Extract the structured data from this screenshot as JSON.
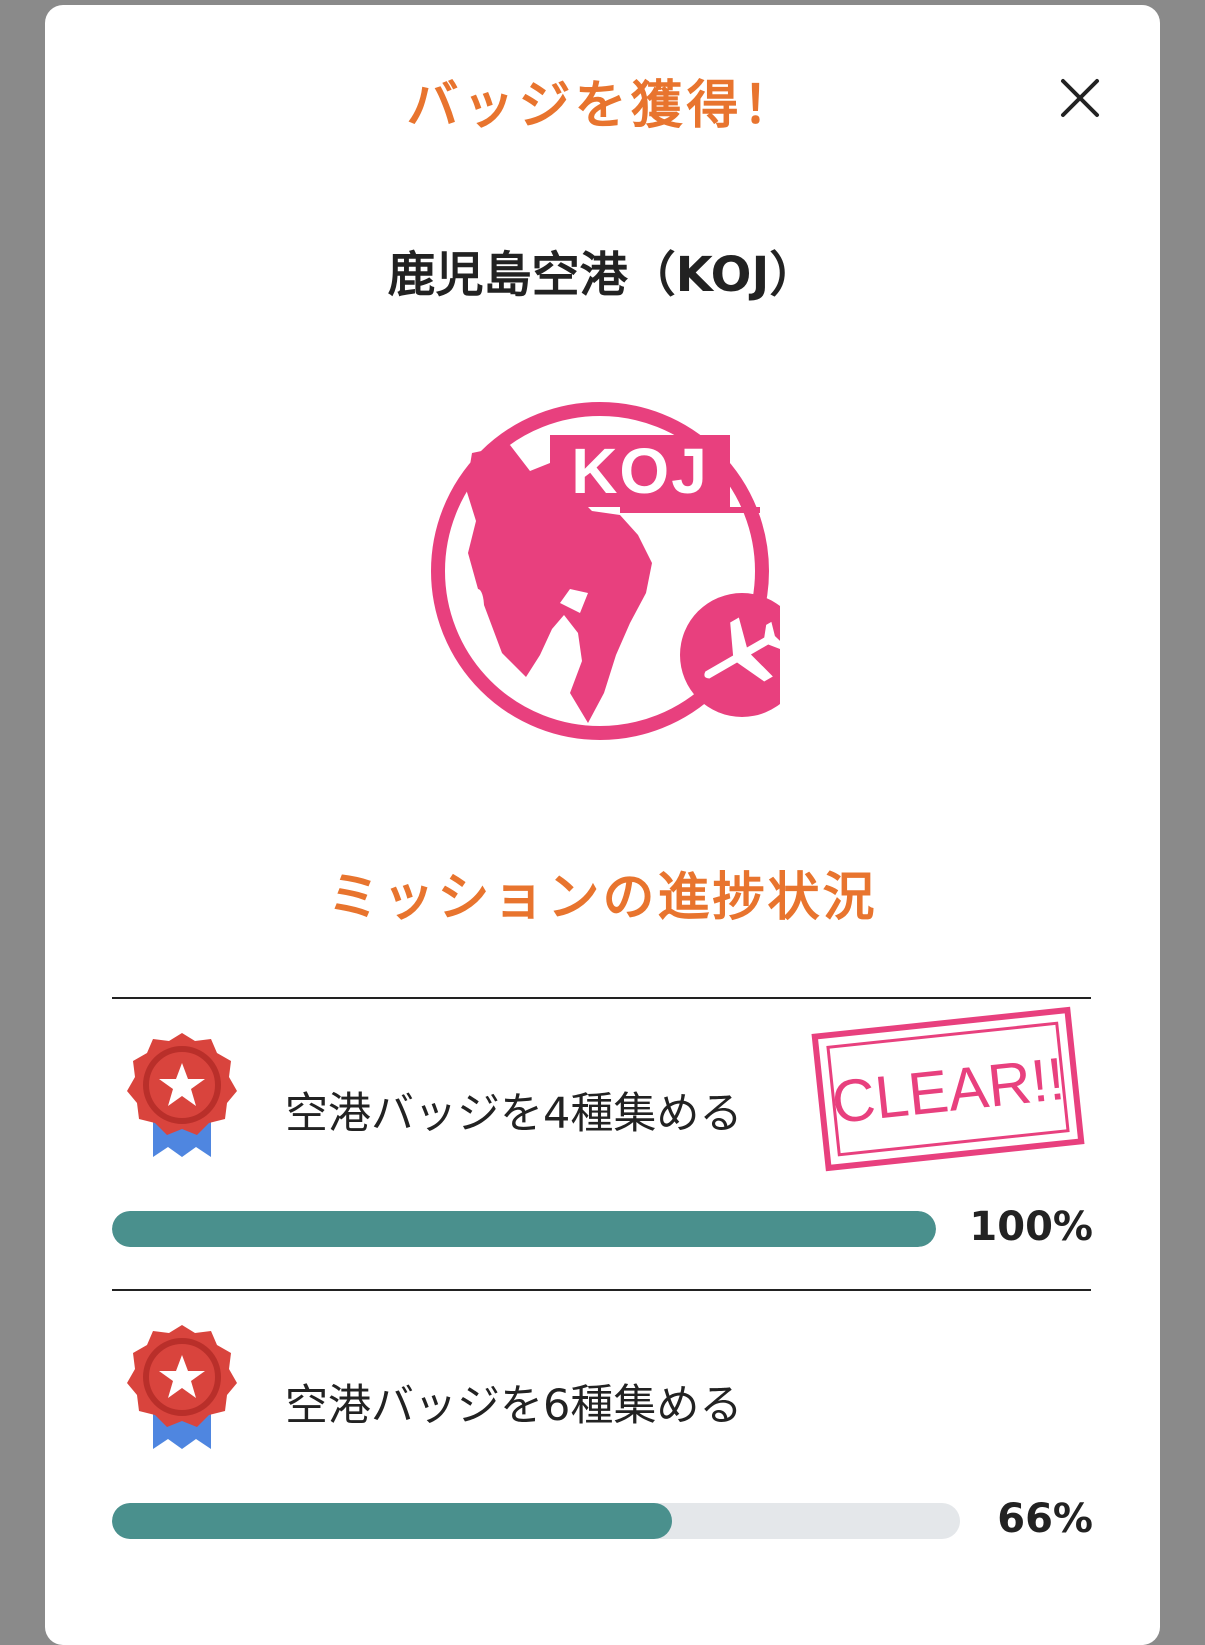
{
  "modal": {
    "title": "バッジを獲得！",
    "airport_name": "鹿児島空港（KOJ）",
    "stamp_code": "KOJ",
    "section_title": "ミッションの進捗状況"
  },
  "missions": [
    {
      "label": "空港バッジを4種集める",
      "progress": 1.0,
      "percent_text": "100%",
      "cleared": true,
      "clear_text": "CLEAR!!"
    },
    {
      "label": "空港バッジを6種集める",
      "progress": 0.66,
      "percent_text": "66%",
      "cleared": false
    }
  ],
  "colors": {
    "accent": "#e8742e",
    "stamp": "#e8407e",
    "progress_fill": "#4a908d",
    "progress_track": "#e4e7ea",
    "medal": "#d9443d",
    "ribbon": "#4f86e0"
  }
}
